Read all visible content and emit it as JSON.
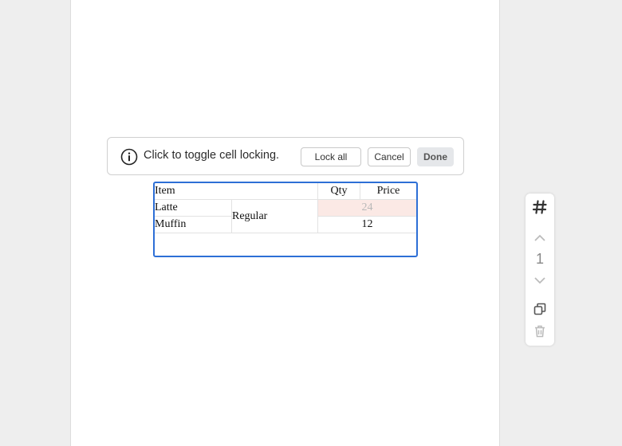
{
  "lock_bar": {
    "message": "Click to toggle cell locking.",
    "lock_all_label": "Lock all",
    "cancel_label": "Cancel",
    "done_label": "Done"
  },
  "table": {
    "headers": [
      "Item",
      "Qty",
      "Price"
    ],
    "rows": [
      {
        "item": "Latte",
        "variant": "Regular",
        "qty": "24",
        "qty_locked": true
      },
      {
        "item": "Muffin",
        "variant": "Regular",
        "qty": "12",
        "qty_locked": false
      }
    ]
  },
  "side_toolbar": {
    "icons": [
      "hash-icon",
      "chevron-up-icon",
      "chevron-down-icon",
      "duplicate-icon",
      "trash-icon"
    ],
    "page_number": "1"
  },
  "colors": {
    "selection_border": "#2d6fd6",
    "locked_cell_bg": "#fbe9e5"
  }
}
